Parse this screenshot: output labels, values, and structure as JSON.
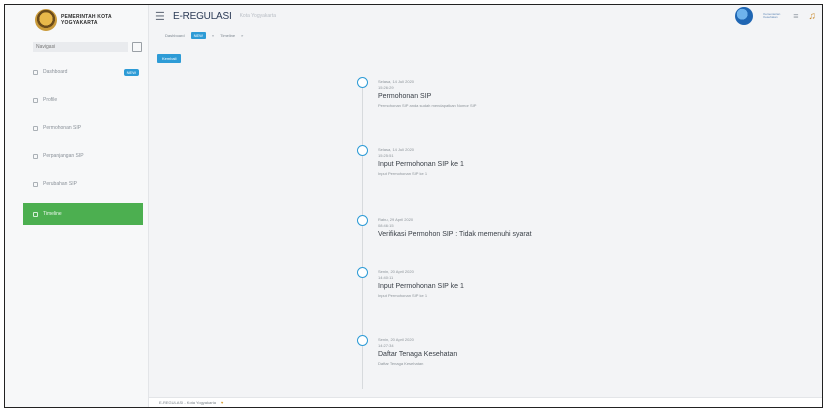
{
  "brand": {
    "line1": "PEMERINTAH KOTA",
    "line2": "YOGYAKARTA",
    "logo_icon": "city-seal-icon"
  },
  "sidebar": {
    "search_placeholder": "Navigasi",
    "items": [
      {
        "label": "Dashboard",
        "icon": "dashboard-icon",
        "badge": "NEW"
      },
      {
        "label": "Profile",
        "icon": "profile-icon"
      },
      {
        "label": "Permohonan SIP",
        "icon": "file-icon"
      },
      {
        "label": "Perpanjangan SIP",
        "icon": "refresh-icon"
      },
      {
        "label": "Perubahan SIP",
        "icon": "edit-icon"
      },
      {
        "label": "Timeline",
        "icon": "timeline-icon",
        "active": true
      }
    ]
  },
  "header": {
    "title": "E-REGULASI",
    "subtitle": "Kota Yogyakarta",
    "ministry_label": "Kementerian Kesehatan"
  },
  "breadcrumb": {
    "first": "Dashboard",
    "first_badge": "NEW",
    "second": "Timeline",
    "separator": "»"
  },
  "back_button": "Kembali",
  "timeline": [
    {
      "date": "Selasa, 14 Juli 2020",
      "time": "15:26:29",
      "title": "Permohonan SIP",
      "desc": "Permohonan SIP anda sudah mendapatkan Nomor SIP"
    },
    {
      "date": "Selasa, 14 Juli 2020",
      "time": "15:25:51",
      "title": "Input Permohonan SIP ke 1",
      "desc": "Input Permohonan SIP ke 1"
    },
    {
      "date": "Rabu, 29 April 2020",
      "time": "08:46:15",
      "title": "Verifikasi Permohon SIP : Tidak memenuhi syarat",
      "desc": ""
    },
    {
      "date": "Senin, 20 April 2020",
      "time": "14:40:11",
      "title": "Input Permohonan SIP ke 1",
      "desc": "Input Permohonan SIP ke 1"
    },
    {
      "date": "Senin, 20 April 2020",
      "time": "14:27:34",
      "title": "Daftar Tenaga Kesehatan",
      "desc": "Daftar Tenaga Kesehatan"
    }
  ],
  "footer": {
    "text": "E-REGULASI - Kota Yogyakarta",
    "heart": "♥"
  }
}
